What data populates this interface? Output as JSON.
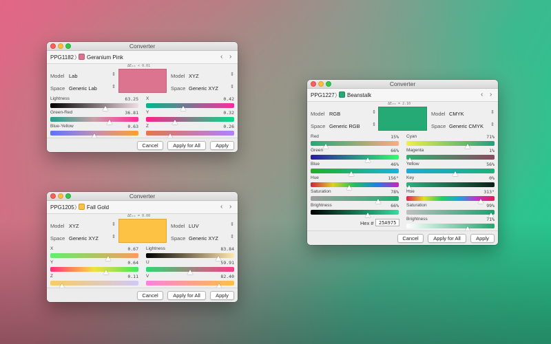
{
  "windows": [
    {
      "title": "Converter",
      "id": "PPG1182",
      "name": "Geranium Pink",
      "swatch": "#dc7490",
      "delta": "ΔE₀₀ < 0.01",
      "left": {
        "model_label": "Model",
        "model": "Lab",
        "space_label": "Space",
        "space": "Generic Lab"
      },
      "right": {
        "model_label": "Model",
        "model": "XYZ",
        "space_label": "Space",
        "space": "Generic XYZ"
      },
      "left_sliders": [
        {
          "label": "Lightness",
          "value": "63.25",
          "pos": 0.63,
          "grad": "linear-gradient(90deg,#000,#f0dde4)"
        },
        {
          "label": "Green-Red",
          "value": "36.81",
          "pos": 0.68,
          "grad": "linear-gradient(90deg,#1fa08a,#c8a0a8,#ff2d9a)"
        },
        {
          "label": "Blue-Yellow",
          "value": "0.63",
          "pos": 0.5,
          "grad": "linear-gradient(90deg,#5b74ff,#c090b5,#ffa030)"
        }
      ],
      "right_sliders": [
        {
          "label": "X",
          "value": "0.42",
          "pos": 0.42,
          "grad": "linear-gradient(90deg,#00b88a,#ff2aa0)"
        },
        {
          "label": "Y",
          "value": "0.32",
          "pos": 0.32,
          "grad": "linear-gradient(90deg,#ff1e8c,#00e08a)"
        },
        {
          "label": "Z",
          "value": "0.26",
          "pos": 0.26,
          "grad": "linear-gradient(90deg,#e07848,#b080ff)"
        }
      ],
      "buttons": {
        "cancel": "Cancel",
        "apply_all": "Apply for All",
        "apply": "Apply"
      }
    },
    {
      "title": "Converter",
      "id": "PPG1205",
      "name": "Fall Gold",
      "swatch": "#fdc144",
      "delta": "ΔE₀₀ = 0.00",
      "left": {
        "model_label": "Model",
        "model": "XYZ",
        "space_label": "Space",
        "space": "Generic XYZ"
      },
      "right": {
        "model_label": "Model",
        "model": "LUV",
        "space_label": "Space",
        "space": "Generic XYZ"
      },
      "left_sliders": [
        {
          "label": "X",
          "value": "0.67",
          "pos": 0.67,
          "grad": "linear-gradient(90deg,#5cf26a,#ff9a5a)"
        },
        {
          "label": "Y",
          "value": "0.64",
          "pos": 0.64,
          "grad": "linear-gradient(90deg,#ff2e78,#f5e040,#40e85a)"
        },
        {
          "label": "Z",
          "value": "0.11",
          "pos": 0.11,
          "grad": "linear-gradient(90deg,#f8cd60,#d0c8f8)"
        }
      ],
      "right_sliders": [
        {
          "label": "Lightness",
          "value": "83.84",
          "pos": 0.84,
          "grad": "linear-gradient(90deg,#000,#ffe7b0)"
        },
        {
          "label": "U",
          "value": "59.91",
          "pos": 0.5,
          "grad": "linear-gradient(90deg,#30d870,#ff3a8a)"
        },
        {
          "label": "V",
          "value": "82.40",
          "pos": 0.85,
          "grad": "linear-gradient(90deg,#ff80e0,#ffc040)"
        }
      ],
      "buttons": {
        "cancel": "Cancel",
        "apply_all": "Apply for All",
        "apply": "Apply"
      }
    },
    {
      "title": "Converter",
      "id": "PPG1227",
      "name": "Beanstalk",
      "swatch": "#25a975",
      "delta": "ΔE₀₀ = 2.10",
      "left": {
        "model_label": "Model",
        "model": "RGB",
        "space_label": "Space",
        "space": "Generic RGB"
      },
      "right": {
        "model_label": "Model",
        "model": "CMYK",
        "space_label": "Space",
        "space": "Generic CMYK"
      },
      "left_sliders": [
        {
          "label": "Red",
          "value": "15%",
          "pos": 0.15,
          "grad": "linear-gradient(90deg,#20aa78,#ffaa80)"
        },
        {
          "label": "Green",
          "value": "66%",
          "pos": 0.66,
          "grad": "linear-gradient(90deg,#2a1aa0,#30ff70)"
        },
        {
          "label": "Blue",
          "value": "46%",
          "pos": 0.46,
          "grad": "linear-gradient(90deg,#20b020,#20b0e0)"
        },
        {
          "label": "Hue",
          "value": "156°",
          "pos": 0.43,
          "grad": "linear-gradient(90deg,#d02040,#e0d020,#20c060,#2080e0,#d020c0)"
        },
        {
          "label": "Saturation",
          "value": "78%",
          "pos": 0.78,
          "grad": "linear-gradient(90deg,#a0a0a0,#20b070)"
        },
        {
          "label": "Brightness",
          "value": "66%",
          "pos": 0.66,
          "grad": "linear-gradient(90deg,#000,#30e0a0)"
        }
      ],
      "right_sliders": [
        {
          "label": "Cyan",
          "value": "71%",
          "pos": 0.71,
          "grad": "linear-gradient(90deg,#f0f048,#20a080)"
        },
        {
          "label": "Magenta",
          "value": "1%",
          "pos": 0.01,
          "grad": "linear-gradient(90deg,#30b070,#8a4a60)"
        },
        {
          "label": "Yellow",
          "value": "56%",
          "pos": 0.56,
          "grad": "linear-gradient(90deg,#20a8d8,#20b078)"
        },
        {
          "label": "Key",
          "value": "0%",
          "pos": 0.0,
          "grad": "linear-gradient(90deg,#30b080,#0a2018)"
        },
        {
          "label": "Hue",
          "value": "313°",
          "pos": 0.87,
          "grad": "linear-gradient(90deg,#e02050,#e0e020,#20d060,#20a0e0,#c030d0,#e02050)"
        },
        {
          "label": "Saturation",
          "value": "99%",
          "pos": 0.99,
          "grad": "linear-gradient(90deg,#c0c0c0,#20a070)"
        },
        {
          "label": "Brightness",
          "value": "71%",
          "pos": 0.71,
          "grad": "linear-gradient(90deg,#fff,#20a870)"
        }
      ],
      "hex_label": "Hex #",
      "hex": "25A975",
      "buttons": {
        "cancel": "Cancel",
        "apply_all": "Apply for All",
        "apply": "Apply"
      }
    }
  ]
}
